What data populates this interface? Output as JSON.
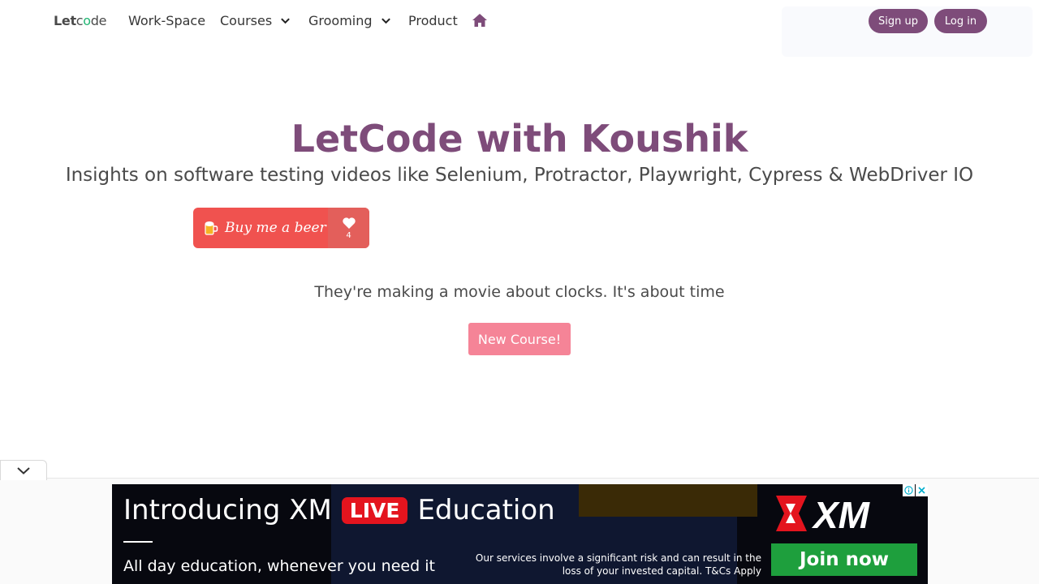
{
  "nav": {
    "logo": {
      "prefix": "Let",
      "c": "c",
      "o": "o",
      "suffix": "de"
    },
    "items": [
      {
        "label": "Work-Space"
      },
      {
        "label": "Courses"
      },
      {
        "label": "Grooming"
      },
      {
        "label": "Product"
      }
    ],
    "signup_label": "Sign up",
    "login_label": "Log in",
    "accent_color": "#7e4c7a"
  },
  "hero": {
    "title": "LetCode with Koushik",
    "subtitle": "Insights on software testing videos like Selenium, Protractor, Playwright, Cypress & WebDriver IO",
    "beer_label": "Buy me a beer",
    "beer_count": "4",
    "joke": "They're making a movie about clocks. It's about time",
    "new_course_label": "New Course!"
  },
  "ad": {
    "headline_before": "Introducing XM",
    "live_badge": "LIVE",
    "headline_after": "Education",
    "tagline": "All day education, whenever you need it",
    "disclaimer": "Our services involve a significant risk and can result in the  loss of your invested capital. T&Cs Apply",
    "brand": "XM",
    "cta": "Join now"
  }
}
